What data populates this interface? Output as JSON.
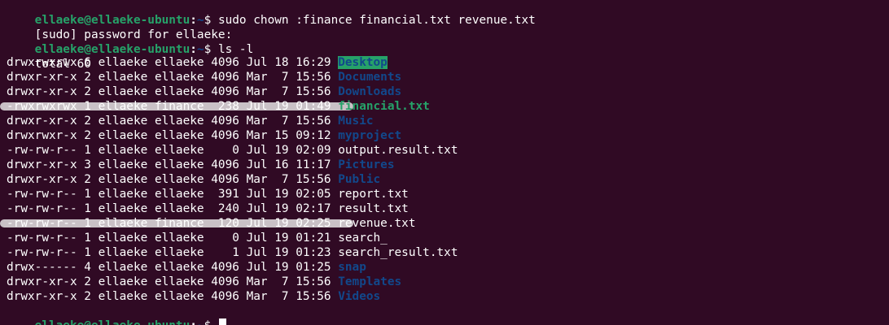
{
  "terminal": {
    "user_host": "ellaeke@ellaeke-ubuntu",
    "path": "~",
    "dollar": "$",
    "lines": [
      {
        "kind": "prompt",
        "command": " sudo chown :finance financial.txt revenue.txt"
      },
      {
        "kind": "text",
        "text": "[sudo] password for ellaeke:"
      },
      {
        "kind": "prompt",
        "command": " ls -l"
      },
      {
        "kind": "text",
        "text": "total 60"
      }
    ],
    "listing": [
      {
        "meta": "drwxrwxrwx 6 ellaeke ellaeke 4096 Jul 18 16:29 ",
        "name": "Desktop",
        "type": "dir-sticky"
      },
      {
        "meta": "drwxr-xr-x 2 ellaeke ellaeke 4096 Mar  7 15:56 ",
        "name": "Documents",
        "type": "dir"
      },
      {
        "meta": "drwxr-xr-x 2 ellaeke ellaeke 4096 Mar  7 15:56 ",
        "name": "Downloads",
        "type": "dir"
      },
      {
        "meta": "-rwxrwxrwx 1 ellaeke finance  238 Jul 19 01:49 ",
        "name": "financial.txt",
        "type": "exec",
        "highlighted": true
      },
      {
        "meta": "drwxr-xr-x 2 ellaeke ellaeke 4096 Mar  7 15:56 ",
        "name": "Music",
        "type": "dir"
      },
      {
        "meta": "drwxrwxr-x 2 ellaeke ellaeke 4096 Mar 15 09:12 ",
        "name": "myproject",
        "type": "dir"
      },
      {
        "meta": "-rw-rw-r-- 1 ellaeke ellaeke    0 Jul 19 02:09 ",
        "name": "output.result.txt",
        "type": "file"
      },
      {
        "meta": "drwxr-xr-x 3 ellaeke ellaeke 4096 Jul 16 11:17 ",
        "name": "Pictures",
        "type": "dir"
      },
      {
        "meta": "drwxr-xr-x 2 ellaeke ellaeke 4096 Mar  7 15:56 ",
        "name": "Public",
        "type": "dir"
      },
      {
        "meta": "-rw-rw-r-- 1 ellaeke ellaeke  391 Jul 19 02:05 ",
        "name": "report.txt",
        "type": "file"
      },
      {
        "meta": "-rw-rw-r-- 1 ellaeke ellaeke  240 Jul 19 02:17 ",
        "name": "result.txt",
        "type": "file"
      },
      {
        "meta": "-rw-rw-r-- 1 ellaeke finance  120 Jul 19 02:25 ",
        "name": "revenue.txt",
        "type": "file",
        "highlighted": true
      },
      {
        "meta": "-rw-rw-r-- 1 ellaeke ellaeke    0 Jul 19 01:21 ",
        "name": "search_",
        "type": "file"
      },
      {
        "meta": "-rw-rw-r-- 1 ellaeke ellaeke    1 Jul 19 01:23 ",
        "name": "search_result.txt",
        "type": "file"
      },
      {
        "meta": "drwx------ 4 ellaeke ellaeke 4096 Jul 19 01:25 ",
        "name": "snap",
        "type": "dir"
      },
      {
        "meta": "drwxr-xr-x 2 ellaeke ellaeke 4096 Mar  7 15:56 ",
        "name": "Templates",
        "type": "dir"
      },
      {
        "meta": "drwxr-xr-x 2 ellaeke ellaeke 4096 Mar  7 15:56 ",
        "name": "Videos",
        "type": "dir"
      }
    ],
    "final_prompt": {
      "command": " "
    }
  },
  "colors": {
    "background": "#300a24",
    "prompt_user": "#26a269",
    "prompt_path": "#12488b",
    "directory": "#12488b",
    "executable": "#26a269",
    "highlight": "#c9c1c6"
  }
}
